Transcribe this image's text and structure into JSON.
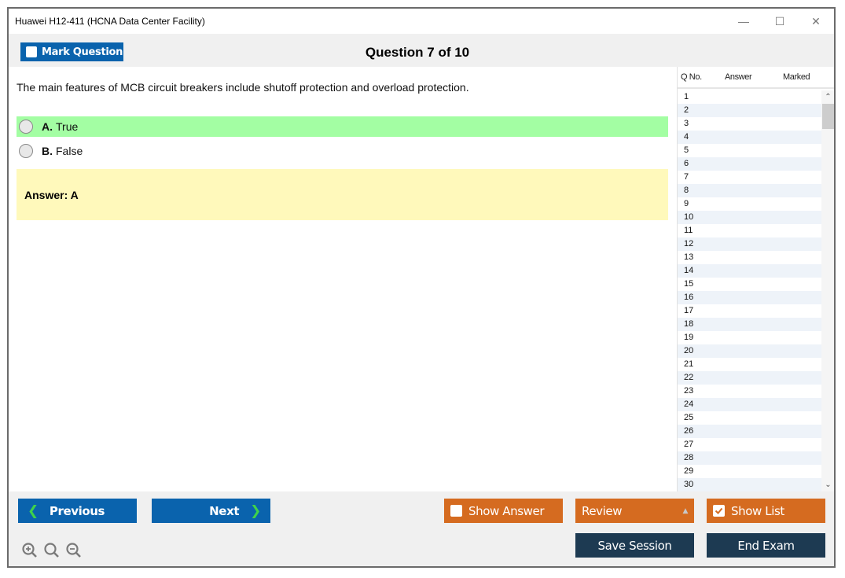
{
  "window": {
    "title": "Huawei H12-411 (HCNA Data Center Facility)",
    "controls": [
      "minimize-icon",
      "maximize-icon",
      "close-icon"
    ]
  },
  "header": {
    "mark_question_label": "Mark Question",
    "question_counter": "Question 7 of 10"
  },
  "question": {
    "text": "The main features of MCB circuit breakers include shutoff protection and overload protection.",
    "options": [
      {
        "letter": "A.",
        "text": "True",
        "correct": true
      },
      {
        "letter": "B.",
        "text": "False",
        "correct": false
      }
    ],
    "answer_text": "Answer: A"
  },
  "question_list": {
    "headers": {
      "no": "Q No.",
      "answer": "Answer",
      "marked": "Marked"
    },
    "rows": [
      "1",
      "2",
      "3",
      "4",
      "5",
      "6",
      "7",
      "8",
      "9",
      "10",
      "11",
      "12",
      "13",
      "14",
      "15",
      "16",
      "17",
      "18",
      "19",
      "20",
      "21",
      "22",
      "23",
      "24",
      "25",
      "26",
      "27",
      "28",
      "29",
      "30"
    ]
  },
  "footer": {
    "previous_label": "Previous",
    "next_label": "Next",
    "show_answer_label": "Show Answer",
    "show_answer_checked": false,
    "review_label": "Review",
    "show_list_label": "Show List",
    "show_list_checked": true,
    "save_session_label": "Save Session",
    "end_exam_label": "End Exam",
    "zoom_icons": [
      "zoom-in-icon",
      "zoom-reset-icon",
      "zoom-out-icon"
    ]
  },
  "colors": {
    "primary_blue": "#0a63ad",
    "orange": "#d56b20",
    "dark_navy": "#1d3a52",
    "correct_green": "#a3fea3",
    "answer_yellow": "#fff9bb",
    "chevron_green": "#3fd24a"
  }
}
